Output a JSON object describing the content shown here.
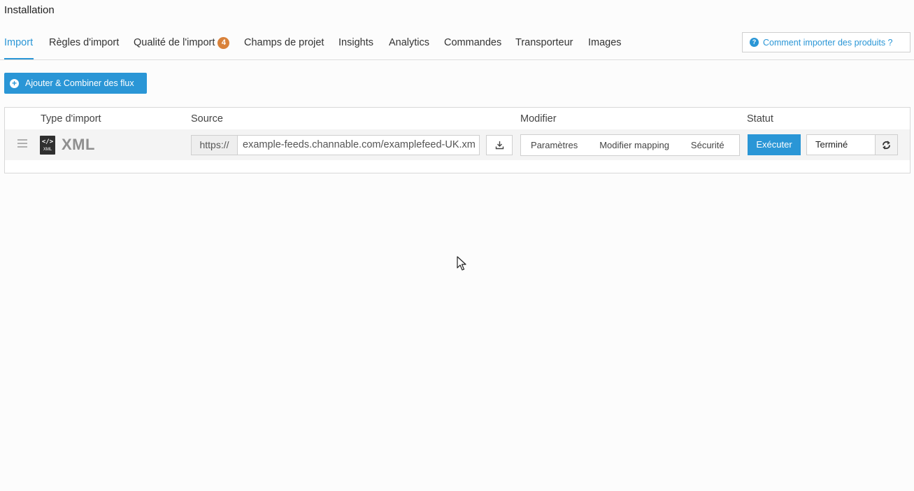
{
  "page": {
    "title": "Installation"
  },
  "tabs": [
    {
      "label": "Import",
      "active": true
    },
    {
      "label": "Règles d'import"
    },
    {
      "label": "Qualité de l'import",
      "badge": "4"
    },
    {
      "label": "Champs de projet"
    },
    {
      "label": "Insights"
    },
    {
      "label": "Analytics"
    },
    {
      "label": "Commandes"
    },
    {
      "label": "Transporteur"
    },
    {
      "label": "Images"
    }
  ],
  "help": {
    "label": "Comment importer des produits ?",
    "icon": "question-circle-icon"
  },
  "toolbar": {
    "add_label": "Ajouter & Combiner des flux",
    "add_icon": "plus-circle-icon"
  },
  "table": {
    "headers": {
      "type": "Type d'import",
      "source": "Source",
      "modify": "Modifier",
      "status": "Statut"
    },
    "rows": [
      {
        "type_label": "XML",
        "type_icon": "xml-file-icon",
        "url_prefix": "https://",
        "url_value": "example-feeds.channable.com/examplefeed-UK.xm",
        "modify_buttons": [
          "Paramètres",
          "Modifier mapping",
          "Sécurité"
        ],
        "execute_label": "Exécuter",
        "status_value": "Terminé"
      }
    ]
  },
  "colors": {
    "accent": "#2a96d6",
    "badge": "#d9823b"
  }
}
